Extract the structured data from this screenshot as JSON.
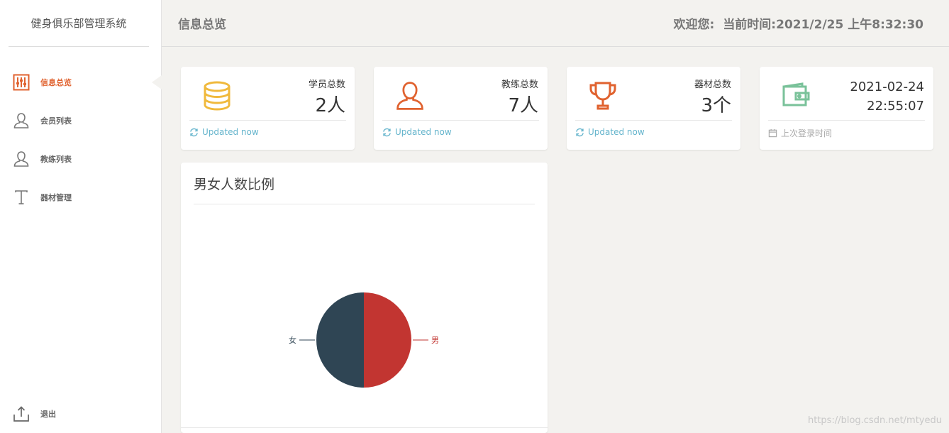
{
  "sidebar": {
    "brand": "健身俱乐部管理系统",
    "items": [
      {
        "label": "信息总览",
        "icon": "sliders-icon"
      },
      {
        "label": "会员列表",
        "icon": "user-icon"
      },
      {
        "label": "教练列表",
        "icon": "user-icon"
      },
      {
        "label": "器材管理",
        "icon": "text-icon"
      }
    ],
    "logout": {
      "label": "退出",
      "icon": "upload-icon"
    }
  },
  "header": {
    "title": "信息总览",
    "welcome": "欢迎您:",
    "time": "当前时间:2021/2/25 上午8:32:30"
  },
  "cards": [
    {
      "label": "学员总数",
      "value": "2人",
      "footer": "Updated now",
      "icon": "database-icon",
      "color": "#f0b93c"
    },
    {
      "label": "教练总数",
      "value": "7人",
      "footer": "Updated now",
      "icon": "user-icon",
      "color": "#e0622f"
    },
    {
      "label": "器材总数",
      "value": "3个",
      "footer": "Updated now",
      "icon": "trophy-icon",
      "color": "#e0622f"
    },
    {
      "date": "2021-02-24",
      "time": "22:55:07",
      "footer": "上次登录时间",
      "icon": "wallet-icon",
      "color": "#7ac29a"
    }
  ],
  "chart_panel": {
    "title": "男女人数比例"
  },
  "chart_data": {
    "type": "pie",
    "title": "",
    "series": [
      {
        "name": "男",
        "value": 1,
        "color": "#c23531"
      },
      {
        "name": "女",
        "value": 1,
        "color": "#2f4554"
      }
    ]
  },
  "watermark": "https://blog.csdn.net/mtyedu"
}
